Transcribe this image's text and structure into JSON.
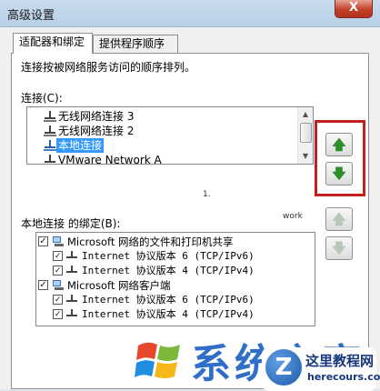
{
  "window": {
    "title": "高级设置",
    "close_label": "X"
  },
  "tabs": [
    {
      "label": "适配器和绑定",
      "active": true
    },
    {
      "label": "提供程序顺序",
      "active": false
    }
  ],
  "description": "连接按被网络服务访问的顺序排列。",
  "connections": {
    "label": "连接(C):",
    "items": [
      {
        "label": "无线网络连接 3",
        "selected": false
      },
      {
        "label": "无线网络连接 2",
        "selected": false
      },
      {
        "label": "本地连接",
        "selected": true
      },
      {
        "label": "VMware Network A",
        "selected": false
      }
    ],
    "up_icon": "arrow-up-icon",
    "down_icon": "arrow-down-icon"
  },
  "bindings": {
    "label": "本地连接 的绑定(B):",
    "tree": [
      {
        "label": "Microsoft 网络的文件和打印机共享",
        "checked": true,
        "level": 0,
        "icon": "network-computer-icon"
      },
      {
        "label": "Internet 协议版本 6 (TCP/IPv6)",
        "checked": true,
        "level": 1,
        "icon": "protocol-icon"
      },
      {
        "label": "Internet 协议版本 4 (TCP/IPv4)",
        "checked": true,
        "level": 1,
        "icon": "protocol-icon"
      },
      {
        "label": "Microsoft 网络客户端",
        "checked": true,
        "level": 0,
        "icon": "network-computer-icon"
      },
      {
        "label": "Internet 协议版本 6 (TCP/IPv6)",
        "checked": true,
        "level": 1,
        "icon": "protocol-icon"
      },
      {
        "label": "Internet 协议版本 4 (TCP/IPv4)",
        "checked": true,
        "level": 1,
        "icon": "protocol-icon"
      }
    ],
    "up_enabled": false,
    "down_enabled": false
  },
  "overlay_fragments": [
    "1.",
    "work"
  ],
  "watermark": {
    "logo_text": "系统之家",
    "site_name": "这里教程网",
    "site_url": "herecours.com"
  },
  "colors": {
    "selection": "#3399ff",
    "highlight_box": "#c2201c",
    "arrow_green": "#2c8f2c"
  }
}
